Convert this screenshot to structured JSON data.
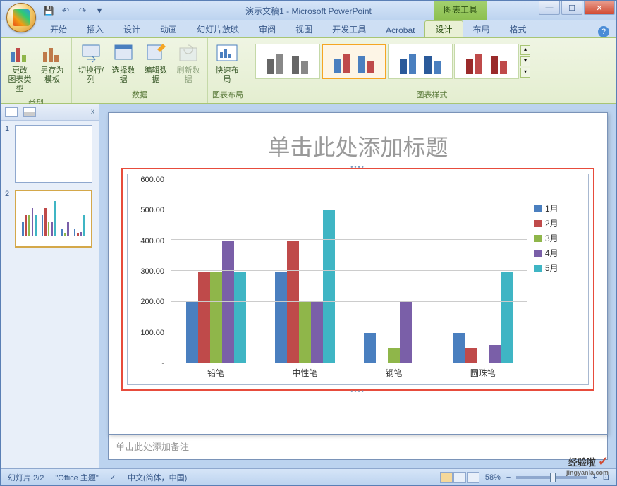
{
  "window": {
    "title": "演示文稿1 - Microsoft PowerPoint",
    "context_tab": "图表工具"
  },
  "tabs": {
    "items": [
      "开始",
      "插入",
      "设计",
      "动画",
      "幻灯片放映",
      "审阅",
      "视图",
      "开发工具",
      "Acrobat",
      "设计",
      "布局",
      "格式"
    ],
    "active_index": 9
  },
  "ribbon": {
    "groups": {
      "type": {
        "label": "类型",
        "change_type": "更改\n图表类型",
        "save_template": "另存为\n模板"
      },
      "data": {
        "label": "数据",
        "switch": "切换行/列",
        "select": "选择数据",
        "edit": "编辑数据",
        "refresh": "刷新数据"
      },
      "layout": {
        "label": "图表布局",
        "quick": "快速布局"
      },
      "styles": {
        "label": "图表样式"
      }
    }
  },
  "slides": {
    "panel_close": "x",
    "items": [
      {
        "num": "1"
      },
      {
        "num": "2"
      }
    ],
    "selected_index": 1
  },
  "slide_content": {
    "title_placeholder": "单击此处添加标题",
    "notes_placeholder": "单击此处添加备注"
  },
  "chart_data": {
    "type": "bar",
    "categories": [
      "铅笔",
      "中性笔",
      "钢笔",
      "圆珠笔"
    ],
    "series": [
      {
        "name": "1月",
        "color": "#4a7fbf",
        "values": [
          200,
          300,
          100,
          100
        ]
      },
      {
        "name": "2月",
        "color": "#bf4a4a",
        "values": [
          300,
          400,
          0,
          50
        ]
      },
      {
        "name": "3月",
        "color": "#8fb64a",
        "values": [
          300,
          200,
          50,
          0
        ]
      },
      {
        "name": "4月",
        "color": "#7a5fa8",
        "values": [
          400,
          200,
          200,
          60
        ]
      },
      {
        "name": "5月",
        "color": "#3fb5c4",
        "values": [
          300,
          500,
          0,
          300
        ]
      }
    ],
    "ylim": [
      0,
      600
    ],
    "y_ticks": [
      "-",
      "100.00",
      "200.00",
      "300.00",
      "400.00",
      "500.00",
      "600.00"
    ]
  },
  "statusbar": {
    "slide_info": "幻灯片 2/2",
    "theme": "\"Office 主题\"",
    "language": "中文(简体，中国)",
    "zoom": "58%"
  },
  "watermark": {
    "text": "经验啦",
    "sub": "jingyanla.com"
  }
}
